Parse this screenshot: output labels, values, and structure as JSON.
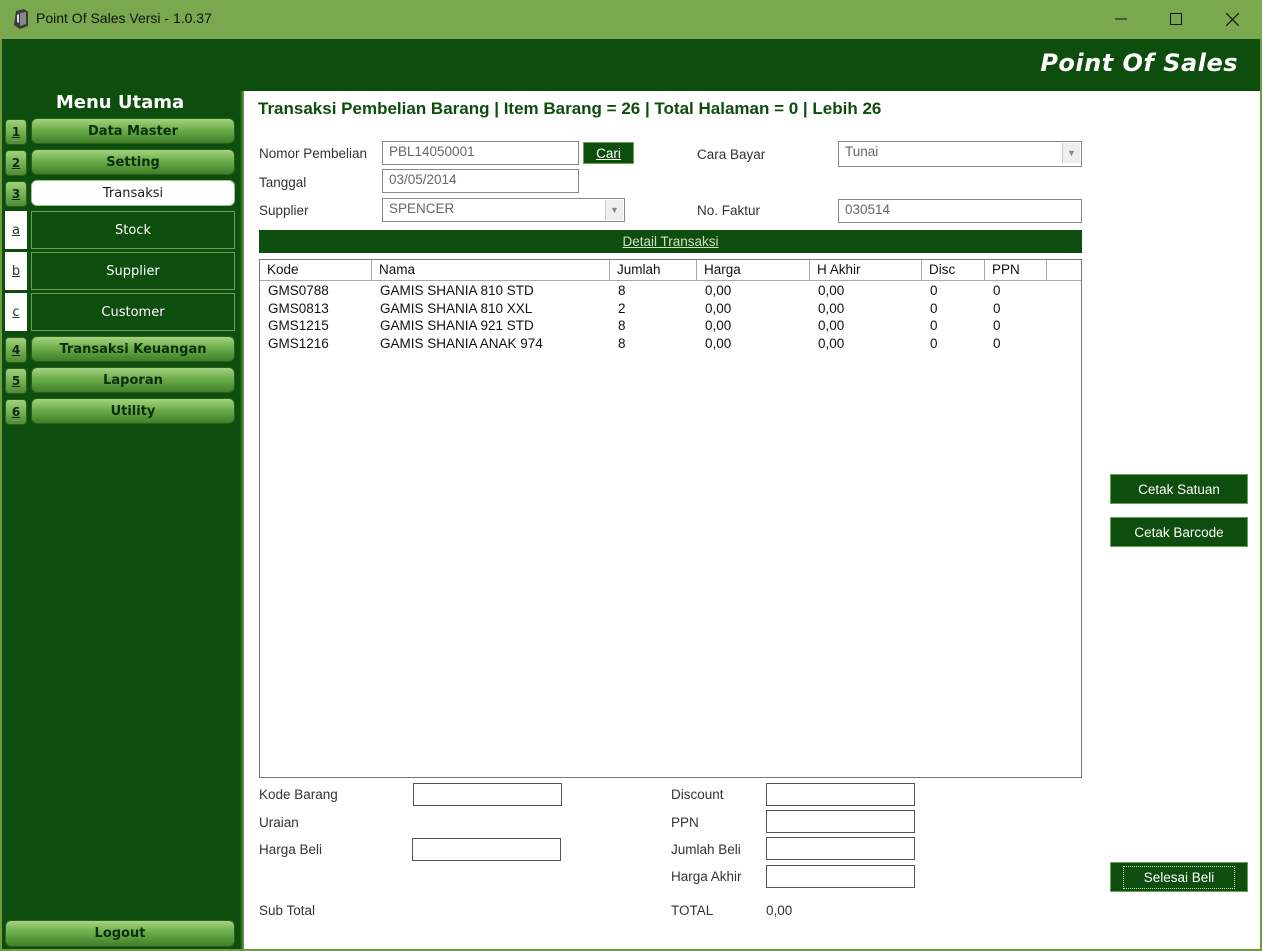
{
  "window": {
    "title": "Point Of Sales Versi - 1.0.37",
    "brand": "Point Of Sales"
  },
  "sidebar": {
    "title": "Menu Utama",
    "items": [
      {
        "key": "1",
        "label": "Data Master"
      },
      {
        "key": "2",
        "label": "Setting"
      },
      {
        "key": "3",
        "label": "Transaksi"
      },
      {
        "key": "4",
        "label": "Transaksi Keuangan"
      },
      {
        "key": "5",
        "label": "Laporan"
      },
      {
        "key": "6",
        "label": "Utility"
      }
    ],
    "subitems": [
      {
        "key": "a",
        "label": "Stock"
      },
      {
        "key": "b",
        "label": "Supplier"
      },
      {
        "key": "c",
        "label": "Customer"
      }
    ],
    "logout": "Logout"
  },
  "form": {
    "page_title": "Transaksi Pembelian Barang | Item Barang = 26 | Total Halaman = 0 | Lebih 26",
    "nomor_label": "Nomor Pembelian",
    "nomor_value": "PBL14050001",
    "cari_label": "Cari",
    "tanggal_label": "Tanggal",
    "tanggal_value": "03/05/2014",
    "supplier_label": "Supplier",
    "supplier_value": "SPENCER",
    "cara_bayar_label": "Cara Bayar",
    "cara_bayar_value": "Tunai",
    "no_faktur_label": "No. Faktur",
    "no_faktur_value": "030514",
    "detail_label": "Detail Transaksi"
  },
  "table": {
    "columns": [
      "Kode",
      "Nama",
      "Jumlah",
      "Harga",
      "H Akhir",
      "Disc",
      "PPN"
    ],
    "rows": [
      [
        "GMS0788",
        "GAMIS SHANIA 810 STD",
        "8",
        "0,00",
        "0,00",
        "0",
        "0"
      ],
      [
        "GMS0813",
        "GAMIS SHANIA 810 XXL",
        "2",
        "0,00",
        "0,00",
        "0",
        "0"
      ],
      [
        "GMS1215",
        "GAMIS SHANIA 921 STD",
        "8",
        "0,00",
        "0,00",
        "0",
        "0"
      ],
      [
        "GMS1216",
        "GAMIS SHANIA ANAK 974",
        "8",
        "0,00",
        "0,00",
        "0",
        "0"
      ]
    ]
  },
  "bottom": {
    "kode_barang_label": "Kode Barang",
    "uraian_label": "Uraian",
    "harga_beli_label": "Harga Beli",
    "sub_total_label": "Sub Total",
    "discount_label": "Discount",
    "ppn_label": "PPN",
    "jumlah_beli_label": "Jumlah Beli",
    "harga_akhir_label": "Harga Akhir",
    "total_label": "TOTAL",
    "total_value": "0,00"
  },
  "actions": {
    "cetak_satuan": "Cetak Satuan",
    "cetak_barcode": "Cetak Barcode",
    "selesai_beli": "Selesai Beli"
  }
}
